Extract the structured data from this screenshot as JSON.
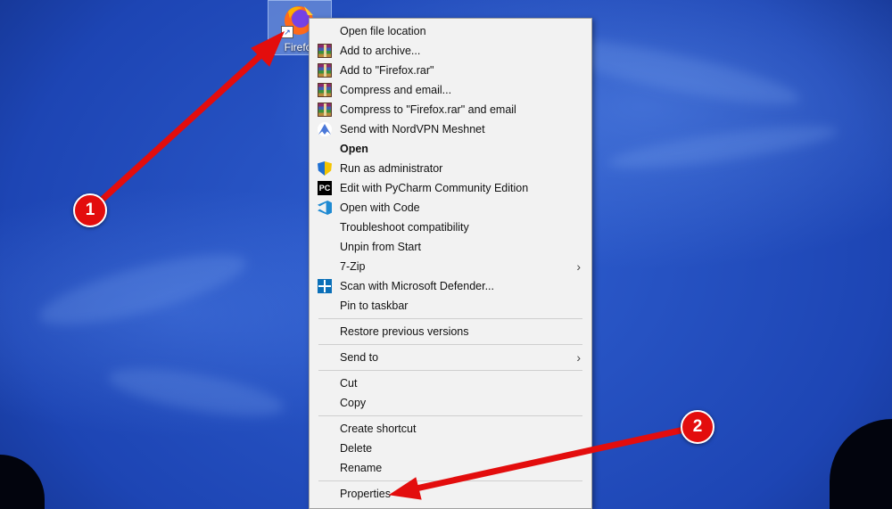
{
  "desktop": {
    "shortcut_name": "Firefox",
    "icon": "firefox-icon",
    "shortcut_overlay": "↗"
  },
  "context_menu": {
    "items": [
      {
        "label": "Open file location",
        "icon": ""
      },
      {
        "label": "Add to archive...",
        "icon": "winrar-icon"
      },
      {
        "label": "Add to \"Firefox.rar\"",
        "icon": "winrar-icon"
      },
      {
        "label": "Compress and email...",
        "icon": "winrar-icon"
      },
      {
        "label": "Compress to \"Firefox.rar\" and email",
        "icon": "winrar-icon"
      },
      {
        "label": "Send with NordVPN Meshnet",
        "icon": "nordvpn-icon"
      },
      {
        "label": "Open",
        "icon": ""
      },
      {
        "label": "Run as administrator",
        "icon": "uac-shield-icon"
      },
      {
        "label": "Edit with PyCharm Community Edition",
        "icon": "pycharm-icon"
      },
      {
        "label": "Open with Code",
        "icon": "vscode-icon"
      },
      {
        "label": "Troubleshoot compatibility",
        "icon": ""
      },
      {
        "label": "Unpin from Start",
        "icon": ""
      },
      {
        "label": "7-Zip",
        "icon": ""
      },
      {
        "label": "Scan with Microsoft Defender...",
        "icon": "defender-icon"
      },
      {
        "label": "Pin to taskbar",
        "icon": ""
      },
      {
        "label": "Restore previous versions",
        "icon": ""
      },
      {
        "label": "Send to",
        "icon": ""
      },
      {
        "label": "Cut",
        "icon": ""
      },
      {
        "label": "Copy",
        "icon": ""
      },
      {
        "label": "Create shortcut",
        "icon": ""
      },
      {
        "label": "Delete",
        "icon": ""
      },
      {
        "label": "Rename",
        "icon": ""
      },
      {
        "label": "Properties",
        "icon": ""
      }
    ],
    "pycharm_glyph": "PC",
    "submenu_arrow": "›"
  },
  "annotations": {
    "badge_1": "1",
    "badge_2": "2",
    "color": "#e30d0d"
  }
}
